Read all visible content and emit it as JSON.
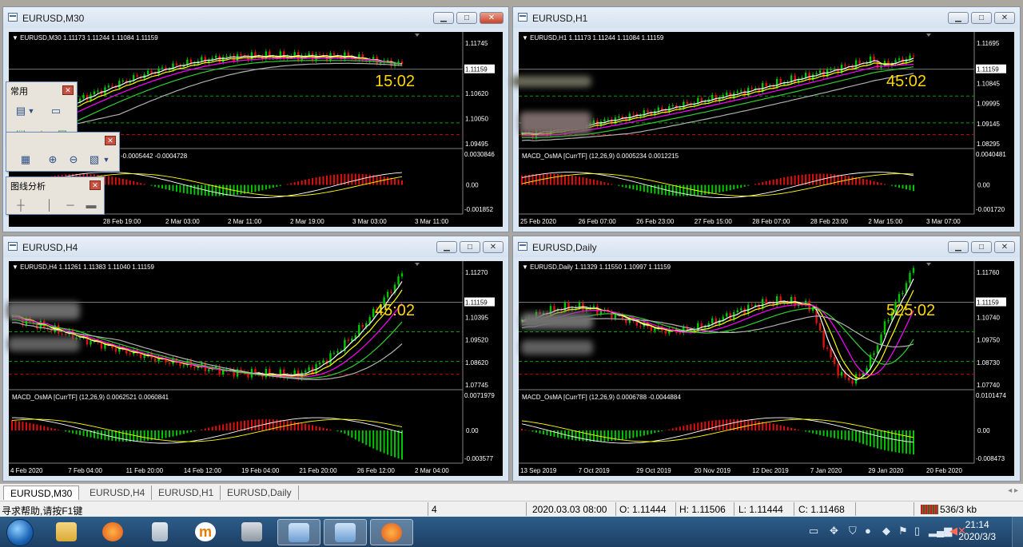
{
  "windows": [
    {
      "title": "EURUSD,M30",
      "info": "EURUSD,M30  1.11173 1.11244 1.11084 1.11159",
      "timer": "15:02",
      "price_labels": [
        "1.11745",
        "1.11159",
        "1.10620",
        "1.10050",
        "1.09495"
      ],
      "current_price": "1.11159",
      "macd_label": "-0.0005442 -0.0004728",
      "macd_labels": [
        "0.0030846",
        "0.00",
        "-0.001852"
      ],
      "time_labels": [
        "28 Feb 19:00",
        "2 Mar 03:00",
        "2 Mar 11:00",
        "2 Mar 19:00",
        "3 Mar 03:00",
        "3 Mar 11:00"
      ]
    },
    {
      "title": "EURUSD,H1",
      "info": "EURUSD,H1  1.11173 1.11244 1.11084 1.11159",
      "timer": "45:02",
      "price_labels": [
        "1.11695",
        "1.11159",
        "1.10845",
        "1.09995",
        "1.09145",
        "1.08295"
      ],
      "current_price": "1.11159",
      "macd_label": "MACD_OsMA [CurrTF] (12,26,9) 0.0005234 0.0012215",
      "macd_labels": [
        "0.0040481",
        "0.00",
        "-0.001720"
      ],
      "time_labels": [
        "25 Feb 2020",
        "26 Feb 07:00",
        "26 Feb 23:00",
        "27 Feb 15:00",
        "28 Feb 07:00",
        "28 Feb 23:00",
        "2 Mar 15:00",
        "3 Mar 07:00"
      ]
    },
    {
      "title": "EURUSD,H4",
      "info": "EURUSD,H4  1.11261 1.11383 1.11040 1.11159",
      "timer": "45:02",
      "price_labels": [
        "1.11270",
        "1.11159",
        "1.10395",
        "1.09520",
        "1.08620",
        "1.07745"
      ],
      "current_price": "1.11159",
      "macd_label": "MACD_OsMA [CurrTF] (12,26,9) 0.0062521 0.0060841",
      "macd_labels": [
        "0.0071979",
        "0.00",
        "-0.003577"
      ],
      "time_labels": [
        "4 Feb 2020",
        "7 Feb 04:00",
        "11 Feb 20:00",
        "14 Feb 12:00",
        "19 Feb 04:00",
        "21 Feb 20:00",
        "26 Feb 12:00",
        "2 Mar 04:00"
      ]
    },
    {
      "title": "EURUSD,Daily",
      "info": "EURUSD,Daily  1.11329 1.11550 1.10997 1.11159",
      "timer": "525:02",
      "price_labels": [
        "1.11760",
        "1.11159",
        "1.10740",
        "1.09750",
        "1.08730",
        "1.07740"
      ],
      "current_price": "1.11159",
      "macd_label": "MACD_OsMA [CurrTF] (12,26,9) 0.0006788 -0.0044884",
      "macd_labels": [
        "0.0101474",
        "0.00",
        "-0.008473"
      ],
      "time_labels": [
        "13 Sep 2019",
        "7 Oct 2019",
        "29 Oct 2019",
        "20 Nov 2019",
        "12 Dec 2019",
        "7 Jan 2020",
        "29 Jan 2020",
        "20 Feb 2020"
      ]
    }
  ],
  "toolbars": {
    "common": {
      "title": "常用"
    },
    "line_analysis": {
      "title": "图线分析"
    }
  },
  "tabs": [
    "EURUSD,M30",
    "EURUSD,H4",
    "EURUSD,H1",
    "EURUSD,Daily"
  ],
  "active_tab": "EURUSD,M30",
  "status": {
    "help": "寻求帮助,请按F1键",
    "count": "4",
    "datetime": "2020.03.03 08:00",
    "open": "O: 1.11444",
    "high": "H: 1.11506",
    "low": "L: 1.11444",
    "close": "C: 1.11468",
    "traffic": "536/3 kb"
  },
  "taskbar": {
    "time": "21:14",
    "date": "2020/3/3"
  },
  "colors": {
    "bull": "#00c800",
    "bear": "#e01010",
    "ma_fast": "#ffffff",
    "ma_yellow": "#ffff00",
    "ma_magenta": "#ff00ff",
    "ma_green": "#32cd32",
    "ma_gray": "#b0b0b0",
    "timer": "#ffd700"
  }
}
